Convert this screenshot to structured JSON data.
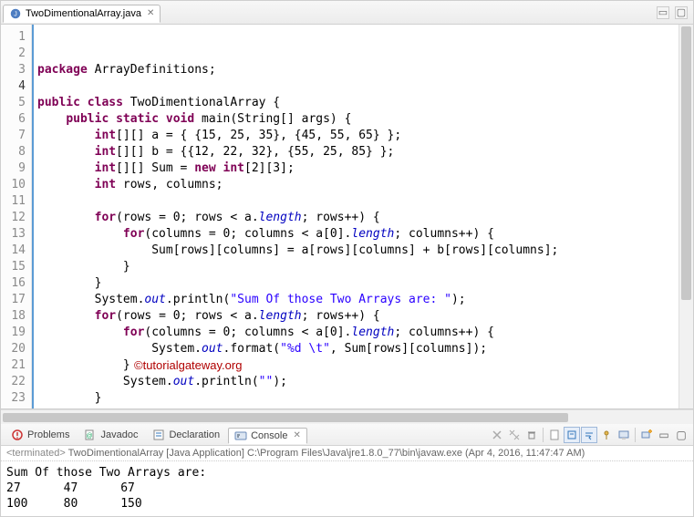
{
  "tab": {
    "filename": "TwoDimentionalArray.java"
  },
  "code": {
    "lines": [
      {
        "n": 1,
        "seg": [
          {
            "t": "package",
            "c": "kw"
          },
          {
            "t": " ArrayDefinitions;"
          }
        ]
      },
      {
        "n": 2,
        "seg": []
      },
      {
        "n": 3,
        "seg": [
          {
            "t": "public",
            "c": "kw"
          },
          {
            "t": " "
          },
          {
            "t": "class",
            "c": "kw"
          },
          {
            "t": " TwoDimentionalArray {"
          }
        ]
      },
      {
        "n": 4,
        "seg": [
          {
            "t": "    "
          },
          {
            "t": "public",
            "c": "kw"
          },
          {
            "t": " "
          },
          {
            "t": "static",
            "c": "kw"
          },
          {
            "t": " "
          },
          {
            "t": "void",
            "c": "kw"
          },
          {
            "t": " main(String[] args) {"
          }
        ]
      },
      {
        "n": 5,
        "seg": [
          {
            "t": "        "
          },
          {
            "t": "int",
            "c": "kw"
          },
          {
            "t": "[][] a = { {15, 25, 35}, {45, 55, 65} };"
          }
        ]
      },
      {
        "n": 6,
        "seg": [
          {
            "t": "        "
          },
          {
            "t": "int",
            "c": "kw"
          },
          {
            "t": "[][] b = {{12, 22, 32}, {55, 25, 85} };"
          }
        ]
      },
      {
        "n": 7,
        "seg": [
          {
            "t": "        "
          },
          {
            "t": "int",
            "c": "kw"
          },
          {
            "t": "[][] Sum = "
          },
          {
            "t": "new",
            "c": "kw"
          },
          {
            "t": " "
          },
          {
            "t": "int",
            "c": "kw"
          },
          {
            "t": "[2][3];"
          }
        ]
      },
      {
        "n": 8,
        "seg": [
          {
            "t": "        "
          },
          {
            "t": "int",
            "c": "kw"
          },
          {
            "t": " rows, columns;"
          }
        ]
      },
      {
        "n": 9,
        "seg": []
      },
      {
        "n": 10,
        "seg": [
          {
            "t": "        "
          },
          {
            "t": "for",
            "c": "kw"
          },
          {
            "t": "(rows = 0; rows < a."
          },
          {
            "t": "length",
            "c": "field"
          },
          {
            "t": "; rows++) {"
          }
        ]
      },
      {
        "n": 11,
        "seg": [
          {
            "t": "            "
          },
          {
            "t": "for",
            "c": "kw"
          },
          {
            "t": "(columns = 0; columns < a[0]."
          },
          {
            "t": "length",
            "c": "field"
          },
          {
            "t": "; columns++) {"
          }
        ]
      },
      {
        "n": 12,
        "seg": [
          {
            "t": "                Sum[rows][columns] = a[rows][columns] + b[rows][columns];"
          }
        ]
      },
      {
        "n": 13,
        "seg": [
          {
            "t": "            }"
          }
        ]
      },
      {
        "n": 14,
        "seg": [
          {
            "t": "        }"
          }
        ]
      },
      {
        "n": 15,
        "seg": [
          {
            "t": "        System."
          },
          {
            "t": "out",
            "c": "field"
          },
          {
            "t": ".println("
          },
          {
            "t": "\"Sum Of those Two Arrays are: \"",
            "c": "str"
          },
          {
            "t": ");"
          }
        ]
      },
      {
        "n": 16,
        "seg": [
          {
            "t": "        "
          },
          {
            "t": "for",
            "c": "kw"
          },
          {
            "t": "(rows = 0; rows < a."
          },
          {
            "t": "length",
            "c": "field"
          },
          {
            "t": "; rows++) {"
          }
        ]
      },
      {
        "n": 17,
        "seg": [
          {
            "t": "            "
          },
          {
            "t": "for",
            "c": "kw"
          },
          {
            "t": "(columns = 0; columns < a[0]."
          },
          {
            "t": "length",
            "c": "field"
          },
          {
            "t": "; columns++) {"
          }
        ]
      },
      {
        "n": 18,
        "seg": [
          {
            "t": "                System."
          },
          {
            "t": "out",
            "c": "field"
          },
          {
            "t": ".format("
          },
          {
            "t": "\"%d \\t\"",
            "c": "str"
          },
          {
            "t": ", Sum[rows][columns]);"
          }
        ]
      },
      {
        "n": 19,
        "seg": [
          {
            "t": "            }"
          }
        ]
      },
      {
        "n": 20,
        "seg": [
          {
            "t": "            System."
          },
          {
            "t": "out",
            "c": "field"
          },
          {
            "t": ".println("
          },
          {
            "t": "\"\"",
            "c": "str"
          },
          {
            "t": ");"
          }
        ]
      },
      {
        "n": 21,
        "seg": [
          {
            "t": "        }"
          }
        ]
      },
      {
        "n": 22,
        "seg": [
          {
            "t": "    }"
          }
        ]
      },
      {
        "n": 23,
        "seg": [
          {
            "t": "}"
          }
        ]
      }
    ]
  },
  "watermark": "©tutorialgateway.org",
  "bottom_tabs": {
    "problems": "Problems",
    "javadoc": "Javadoc",
    "declaration": "Declaration",
    "console": "Console"
  },
  "console": {
    "status_prefix": "<terminated>",
    "status_main": " TwoDimentionalArray [Java Application] C:\\Program Files\\Java\\jre1.8.0_77\\bin\\javaw.exe (Apr 4, 2016, 11:47:47 AM)",
    "output": "Sum Of those Two Arrays are:\n27      47      67\n100     80      150"
  },
  "icons": {
    "close": "✕",
    "minimize": "▭",
    "maximize": "▢"
  }
}
